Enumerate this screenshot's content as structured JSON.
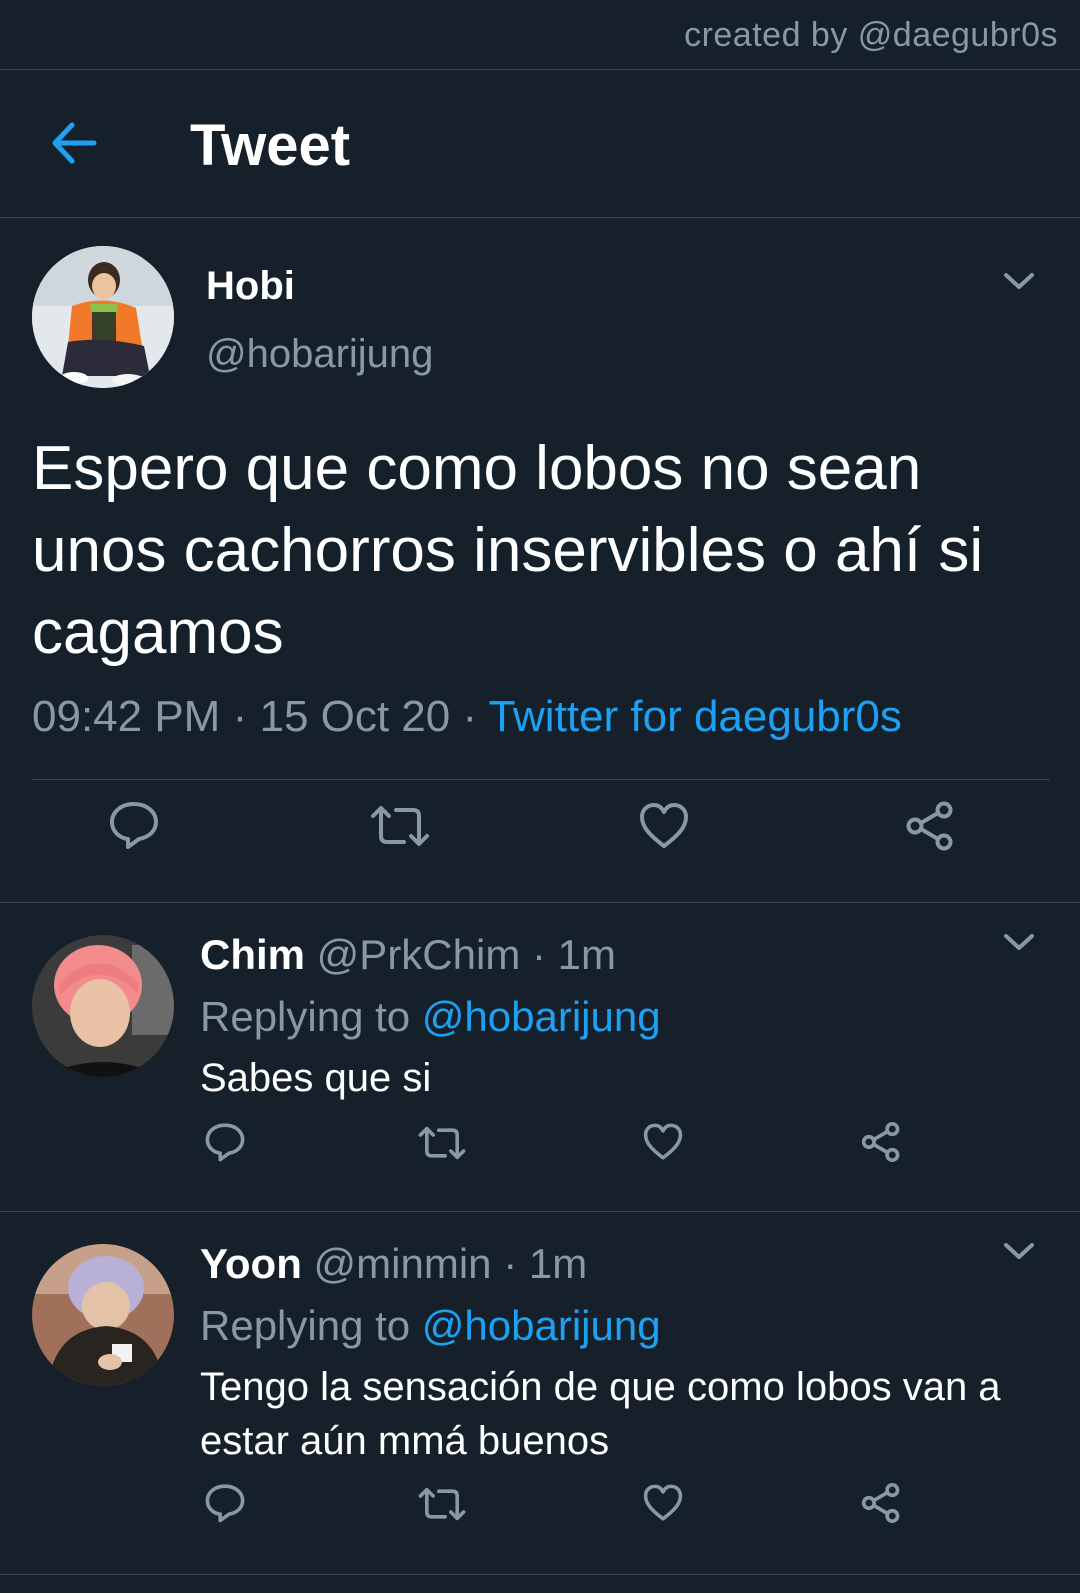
{
  "credit": "created by @daegubr0s",
  "header": {
    "title": "Tweet",
    "back_icon": "arrow-left-icon"
  },
  "colors": {
    "background": "#15202b",
    "accent": "#1da1f2",
    "muted": "#8899a6",
    "divider": "#38444d"
  },
  "main_tweet": {
    "name": "Hobi",
    "handle": "@hobarijung",
    "text": "Espero que como lobos no sean unos cachorros inservibles o ahí si cagamos",
    "time": "09:42 PM",
    "separator": "·",
    "date": "15 Oct 20",
    "source": "Twitter for daegubr0s",
    "actions": [
      "reply-icon",
      "retweet-icon",
      "like-icon",
      "share-icon"
    ]
  },
  "replies": [
    {
      "name": "Chim",
      "handle": "@PrkChim",
      "time": "· 1m",
      "replying_prefix": "Replying to",
      "replying_to": "@hobarijung",
      "text": "Sabes que si"
    },
    {
      "name": "Yoon",
      "handle": "@minmin",
      "time": "· 1m",
      "replying_prefix": "Replying to",
      "replying_to": "@hobarijung",
      "text": "Tengo la sensación de que como lobos van a estar aún mmá buenos"
    }
  ]
}
